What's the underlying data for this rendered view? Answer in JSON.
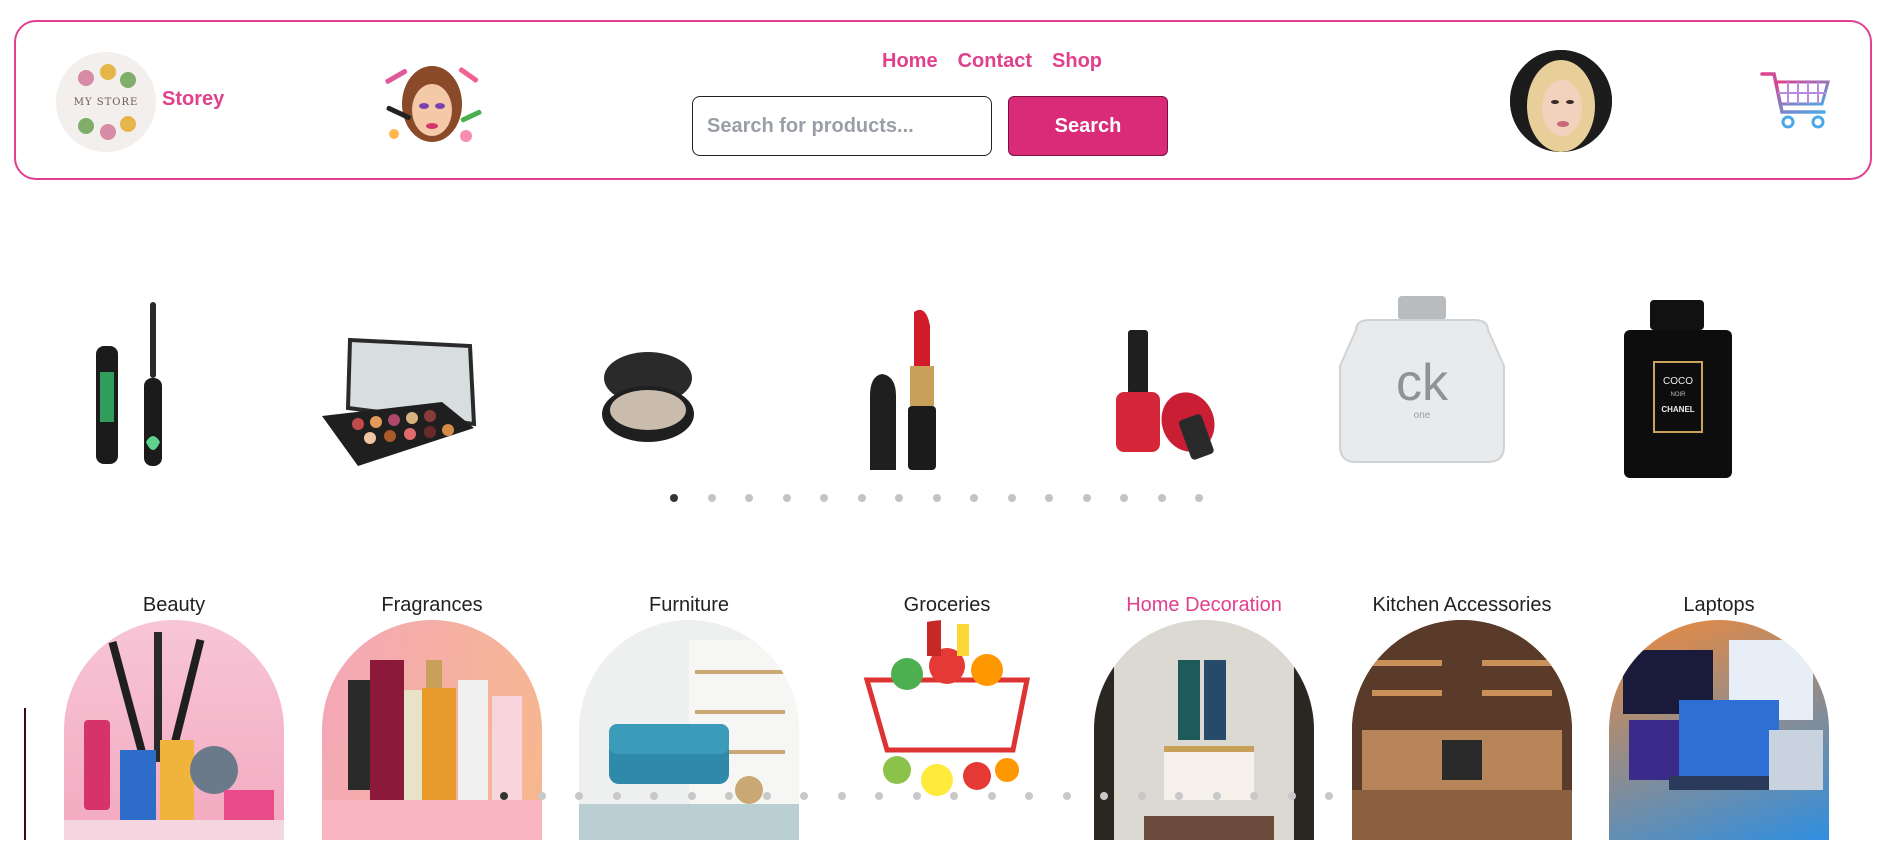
{
  "header": {
    "logo_text": "MY STORE",
    "brand": "Storey",
    "nav": [
      "Home",
      "Contact",
      "Shop"
    ],
    "search": {
      "placeholder": "Search for products...",
      "value": ""
    },
    "search_button": "Search"
  },
  "products": [
    {
      "name": "mascara"
    },
    {
      "name": "eyeshadow palette"
    },
    {
      "name": "compact powder"
    },
    {
      "name": "lipstick"
    },
    {
      "name": "nail polish"
    },
    {
      "name": "ck one perfume",
      "label": "ck",
      "sub": "one"
    },
    {
      "name": "chanel coco noir perfume",
      "label_top": "COCO",
      "label_mid": "NOIR",
      "label_brand": "CHANEL"
    }
  ],
  "carousel": {
    "dot_count": 15,
    "active_index": 0
  },
  "categories": [
    {
      "label": "Beauty",
      "active": false
    },
    {
      "label": "Fragrances",
      "active": false
    },
    {
      "label": "Furniture",
      "active": false
    },
    {
      "label": "Groceries",
      "active": false
    },
    {
      "label": "Home Decoration",
      "active": true
    },
    {
      "label": "Kitchen Accessories",
      "active": false
    },
    {
      "label": "Laptops",
      "active": false
    }
  ],
  "category_carousel": {
    "dot_count": 23,
    "active_index": 0
  },
  "colors": {
    "accent": "#e0408c",
    "button": "#d92b78"
  }
}
